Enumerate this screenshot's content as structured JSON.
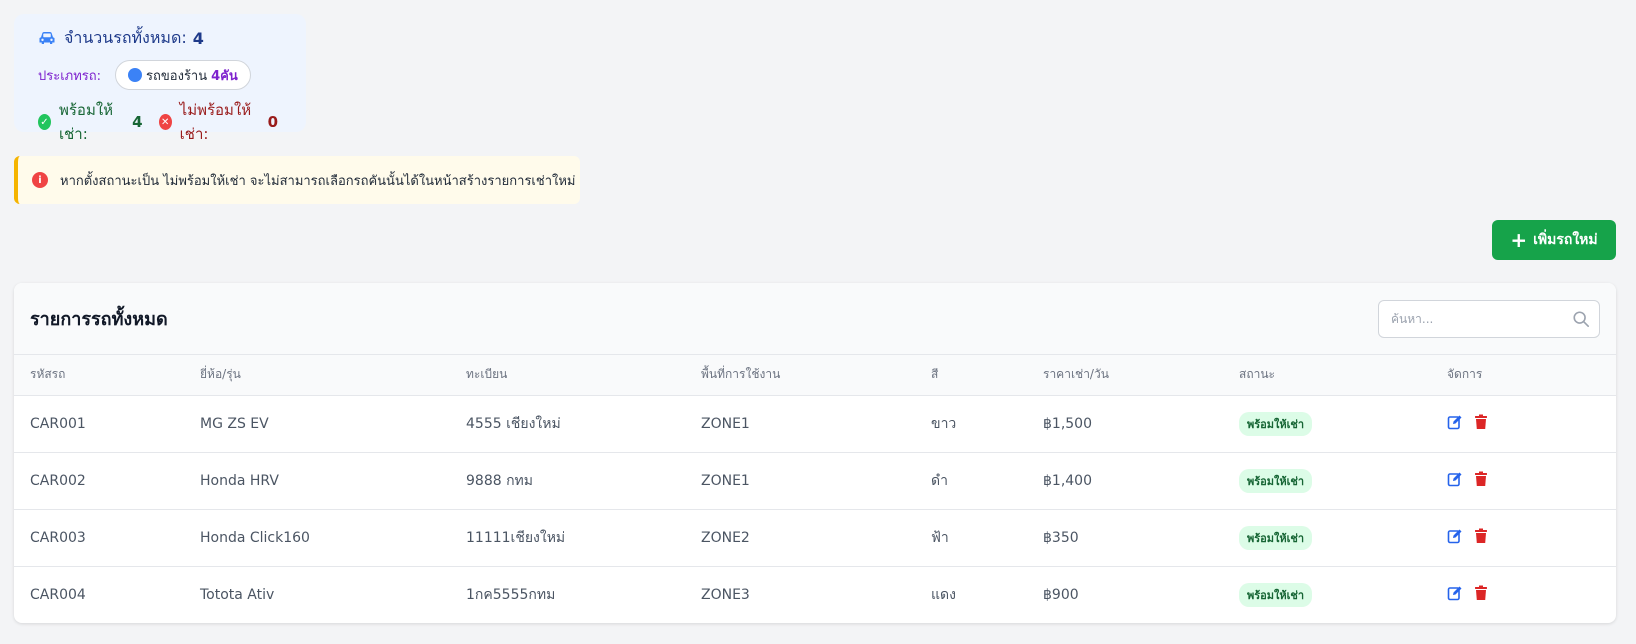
{
  "summary": {
    "total_label": "จำนวนรถทั้งหมด:",
    "total_value": "4",
    "type_label": "ประเภทรถ:",
    "type_pill_name": "รถของร้าน",
    "type_pill_count": "4คัน",
    "available_label": "พร้อมให้เช่า:",
    "available_value": "4",
    "unavailable_label": "ไม่พร้อมให้เช่า:",
    "unavailable_value": "0"
  },
  "alert": {
    "text": "หากตั้งสถานะเป็น ไม่พร้อมให้เช่า จะไม่สามารถเลือกรถคันนั้นได้ในหน้าสร้างรายการเช่าใหม่"
  },
  "add_button": {
    "label": "เพิ่มรถใหม่"
  },
  "card": {
    "title": "รายการรถทั้งหมด",
    "search_placeholder": "ค้นหา..."
  },
  "table": {
    "headers": [
      "รหัสรถ",
      "ยี่ห้อ/รุ่น",
      "ทะเบียน",
      "พื้นที่การใช้งาน",
      "สี",
      "ราคาเช่า/วัน",
      "สถานะ",
      "จัดการ"
    ],
    "rows": [
      {
        "id": "CAR001",
        "model": "MG ZS EV",
        "plate": "4555 เชียงใหม่",
        "zone": "ZONE1",
        "color": "ขาว",
        "price": "฿1,500",
        "status": "พร้อมให้เช่า"
      },
      {
        "id": "CAR002",
        "model": "Honda HRV",
        "plate": "9888 กทม",
        "zone": "ZONE1",
        "color": "ดำ",
        "price": "฿1,400",
        "status": "พร้อมให้เช่า"
      },
      {
        "id": "CAR003",
        "model": "Honda Click160",
        "plate": "11111เชียงใหม่",
        "zone": "ZONE2",
        "color": "ฟ้า",
        "price": "฿350",
        "status": "พร้อมให้เช่า"
      },
      {
        "id": "CAR004",
        "model": "Totota Ativ",
        "plate": "1กค5555กทม",
        "zone": "ZONE3",
        "color": "แดง",
        "price": "฿900",
        "status": "พร้อมให้เช่า"
      }
    ]
  },
  "colors": {
    "accent_green": "#16a34a",
    "edit_blue": "#2563eb",
    "delete_red": "#dc2626",
    "status_bg": "#dcfce7"
  },
  "icons": {
    "summary": "car-icon",
    "available": "check-circle-icon",
    "unavailable": "x-circle-icon",
    "alert": "info-circle-icon",
    "add": "plus-icon",
    "search": "search-icon",
    "edit": "edit-icon",
    "delete": "trash-icon"
  }
}
